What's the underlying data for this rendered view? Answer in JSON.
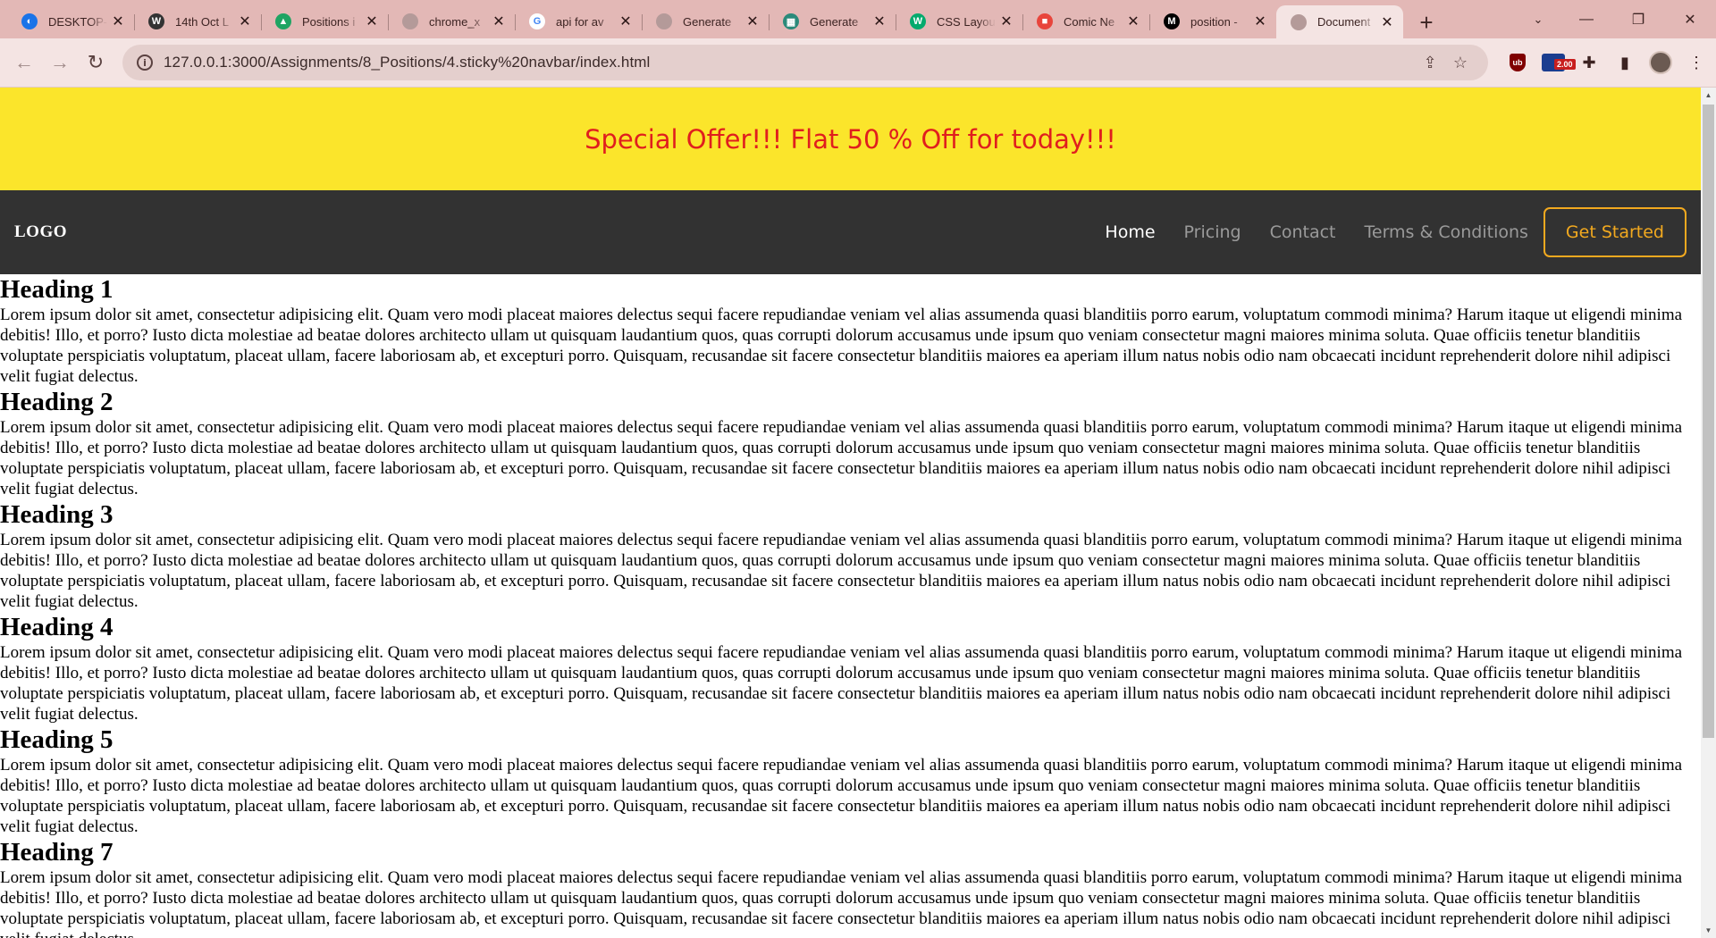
{
  "browser": {
    "tabs": [
      {
        "title": "DESKTOP-",
        "icon": "chrome-remote-icon",
        "color": "#1a73e8",
        "glyph": "◐"
      },
      {
        "title": "14th Oct L",
        "icon": "wordpress-icon",
        "color": "#333333",
        "glyph": "W"
      },
      {
        "title": "Positions i",
        "icon": "google-drive-icon",
        "color": "#1fa463",
        "glyph": "▲"
      },
      {
        "title": "chrome_x",
        "icon": "globe-icon",
        "color": "#b49a99",
        "glyph": ""
      },
      {
        "title": "api for av",
        "icon": "google-icon",
        "color": "#ffffff",
        "glyph": "G"
      },
      {
        "title": "Generate",
        "icon": "globe-icon",
        "color": "#b49a99",
        "glyph": ""
      },
      {
        "title": "Generate",
        "icon": "checker-icon",
        "color": "#2a8a7a",
        "glyph": "▦"
      },
      {
        "title": "CSS Layou",
        "icon": "w3schools-icon",
        "color": "#04aa6d",
        "glyph": "W"
      },
      {
        "title": "Comic Ne",
        "icon": "google-fonts-icon",
        "color": "#e8453c",
        "glyph": "■"
      },
      {
        "title": "position -",
        "icon": "mdn-icon",
        "color": "#000000",
        "glyph": "M"
      },
      {
        "title": "Document",
        "icon": "globe-icon",
        "color": "#b49a99",
        "glyph": "",
        "active": true
      }
    ],
    "url": "127.0.0.1:3000/Assignments/8_Positions/4.sticky%20navbar/index.html",
    "speed_badge": "2.00"
  },
  "page": {
    "offer_text": "Special Offer!!! Flat 50 % Off for today!!!",
    "logo": "LOGO",
    "nav": {
      "home": "Home",
      "pricing": "Pricing",
      "contact": "Contact",
      "terms": "Terms & Conditions",
      "cta": "Get Started"
    },
    "sections": [
      {
        "heading": "Heading 1",
        "body": "Lorem ipsum dolor sit amet, consectetur adipisicing elit. Quam vero modi placeat maiores delectus sequi facere repudiandae veniam vel alias assumenda quasi blanditiis porro earum, voluptatum commodi minima? Harum itaque ut eligendi minima debitis! Illo, et porro? Iusto dicta molestiae ad beatae dolores architecto ullam ut quisquam laudantium quos, quas corrupti dolorum accusamus unde ipsum quo veniam consectetur magni maiores minima soluta. Quae officiis tenetur blanditiis voluptate perspiciatis voluptatum, placeat ullam, facere laboriosam ab, et excepturi porro. Quisquam, recusandae sit facere consectetur blanditiis maiores ea aperiam illum natus nobis odio nam obcaecati incidunt reprehenderit dolore nihil adipisci velit fugiat delectus."
      },
      {
        "heading": "Heading 2",
        "body": "Lorem ipsum dolor sit amet, consectetur adipisicing elit. Quam vero modi placeat maiores delectus sequi facere repudiandae veniam vel alias assumenda quasi blanditiis porro earum, voluptatum commodi minima? Harum itaque ut eligendi minima debitis! Illo, et porro? Iusto dicta molestiae ad beatae dolores architecto ullam ut quisquam laudantium quos, quas corrupti dolorum accusamus unde ipsum quo veniam consectetur magni maiores minima soluta. Quae officiis tenetur blanditiis voluptate perspiciatis voluptatum, placeat ullam, facere laboriosam ab, et excepturi porro. Quisquam, recusandae sit facere consectetur blanditiis maiores ea aperiam illum natus nobis odio nam obcaecati incidunt reprehenderit dolore nihil adipisci velit fugiat delectus."
      },
      {
        "heading": "Heading 3",
        "body": "Lorem ipsum dolor sit amet, consectetur adipisicing elit. Quam vero modi placeat maiores delectus sequi facere repudiandae veniam vel alias assumenda quasi blanditiis porro earum, voluptatum commodi minima? Harum itaque ut eligendi minima debitis! Illo, et porro? Iusto dicta molestiae ad beatae dolores architecto ullam ut quisquam laudantium quos, quas corrupti dolorum accusamus unde ipsum quo veniam consectetur magni maiores minima soluta. Quae officiis tenetur blanditiis voluptate perspiciatis voluptatum, placeat ullam, facere laboriosam ab, et excepturi porro. Quisquam, recusandae sit facere consectetur blanditiis maiores ea aperiam illum natus nobis odio nam obcaecati incidunt reprehenderit dolore nihil adipisci velit fugiat delectus."
      },
      {
        "heading": "Heading 4",
        "body": "Lorem ipsum dolor sit amet, consectetur adipisicing elit. Quam vero modi placeat maiores delectus sequi facere repudiandae veniam vel alias assumenda quasi blanditiis porro earum, voluptatum commodi minima? Harum itaque ut eligendi minima debitis! Illo, et porro? Iusto dicta molestiae ad beatae dolores architecto ullam ut quisquam laudantium quos, quas corrupti dolorum accusamus unde ipsum quo veniam consectetur magni maiores minima soluta. Quae officiis tenetur blanditiis voluptate perspiciatis voluptatum, placeat ullam, facere laboriosam ab, et excepturi porro. Quisquam, recusandae sit facere consectetur blanditiis maiores ea aperiam illum natus nobis odio nam obcaecati incidunt reprehenderit dolore nihil adipisci velit fugiat delectus."
      },
      {
        "heading": "Heading 5",
        "body": "Lorem ipsum dolor sit amet, consectetur adipisicing elit. Quam vero modi placeat maiores delectus sequi facere repudiandae veniam vel alias assumenda quasi blanditiis porro earum, voluptatum commodi minima? Harum itaque ut eligendi minima debitis! Illo, et porro? Iusto dicta molestiae ad beatae dolores architecto ullam ut quisquam laudantium quos, quas corrupti dolorum accusamus unde ipsum quo veniam consectetur magni maiores minima soluta. Quae officiis tenetur blanditiis voluptate perspiciatis voluptatum, placeat ullam, facere laboriosam ab, et excepturi porro. Quisquam, recusandae sit facere consectetur blanditiis maiores ea aperiam illum natus nobis odio nam obcaecati incidunt reprehenderit dolore nihil adipisci velit fugiat delectus."
      },
      {
        "heading": "Heading 7",
        "body": "Lorem ipsum dolor sit amet, consectetur adipisicing elit. Quam vero modi placeat maiores delectus sequi facere repudiandae veniam vel alias assumenda quasi blanditiis porro earum, voluptatum commodi minima? Harum itaque ut eligendi minima debitis! Illo, et porro? Iusto dicta molestiae ad beatae dolores architecto ullam ut quisquam laudantium quos, quas corrupti dolorum accusamus unde ipsum quo veniam consectetur magni maiores minima soluta. Quae officiis tenetur blanditiis voluptate perspiciatis voluptatum, placeat ullam, facere laboriosam ab, et excepturi porro. Quisquam, recusandae sit facere consectetur blanditiis maiores ea aperiam illum natus nobis odio nam obcaecati incidunt reprehenderit dolore nihil adipisci velit fugiat delectus."
      }
    ]
  },
  "colors": {
    "offer_bg": "#fbe52b",
    "offer_text": "#e01e1e",
    "navbar_bg": "#323232",
    "cta": "#f2a91f",
    "tabstrip": "#e3b8b6"
  }
}
